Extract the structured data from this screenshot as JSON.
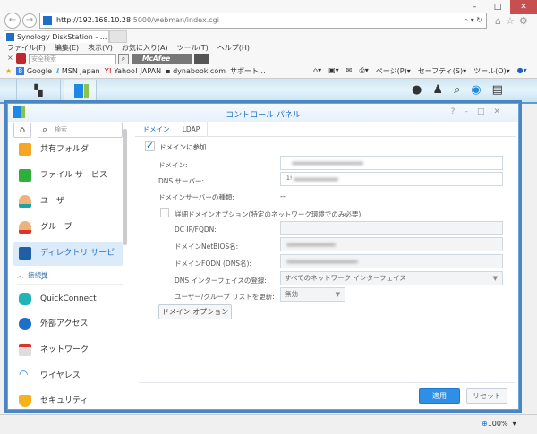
{
  "browser": {
    "url_host": "http://192.168.10.28",
    "url_rest": ":5000/webman/index.cgi",
    "tab_title": "Synology DiskStation - ...",
    "menu": [
      "ファイル(F)",
      "編集(E)",
      "表示(V)",
      "お気に入り(A)",
      "ツール(T)",
      "ヘルプ(H)"
    ],
    "search_placeholder": "安全検索",
    "mcafee": "McAfee",
    "favorites": [
      "Google",
      "MSN Japan",
      "Yahoo! JAPAN",
      "dynabook.com",
      "サポート..."
    ],
    "cmd": [
      "ページ(P)",
      "セーフティ(S)",
      "ツール(O)"
    ],
    "zoom": "100%"
  },
  "window": {
    "title": "コントロール パネル",
    "search_placeholder": "検索"
  },
  "sidebar": {
    "items": [
      "共有フォルダ",
      "ファイル サービス",
      "ユーザー",
      "グループ",
      "ディレクトリ サービス"
    ],
    "section": "接続性",
    "items2": [
      "QuickConnect",
      "外部アクセス",
      "ネットワーク",
      "ワイヤレス",
      "セキュリティ"
    ]
  },
  "tabs": [
    "ドメイン",
    "LDAP"
  ],
  "form": {
    "join": "ドメインに参加",
    "domain": "ドメイン:",
    "dns": "DNS サーバー:",
    "dns_value": "1!",
    "type": "ドメインサーバーの種類:",
    "type_value": "--",
    "advanced": "詳細ドメインオプション(特定のネットワーク環境でのみ必要)",
    "dc": "DC IP/FQDN:",
    "netbios": "ドメインNetBIOS名:",
    "fqdn": "ドメインFQDN (DNS名):",
    "dnsreg": "DNS インターフェイスの登録:",
    "dnsreg_value": "すべてのネットワーク インターフェイス",
    "update": "ユーザー/グループ リストを更新:",
    "update_value": "無効",
    "options_button": "ドメイン オプション",
    "apply": "適用",
    "reset": "リセット"
  }
}
